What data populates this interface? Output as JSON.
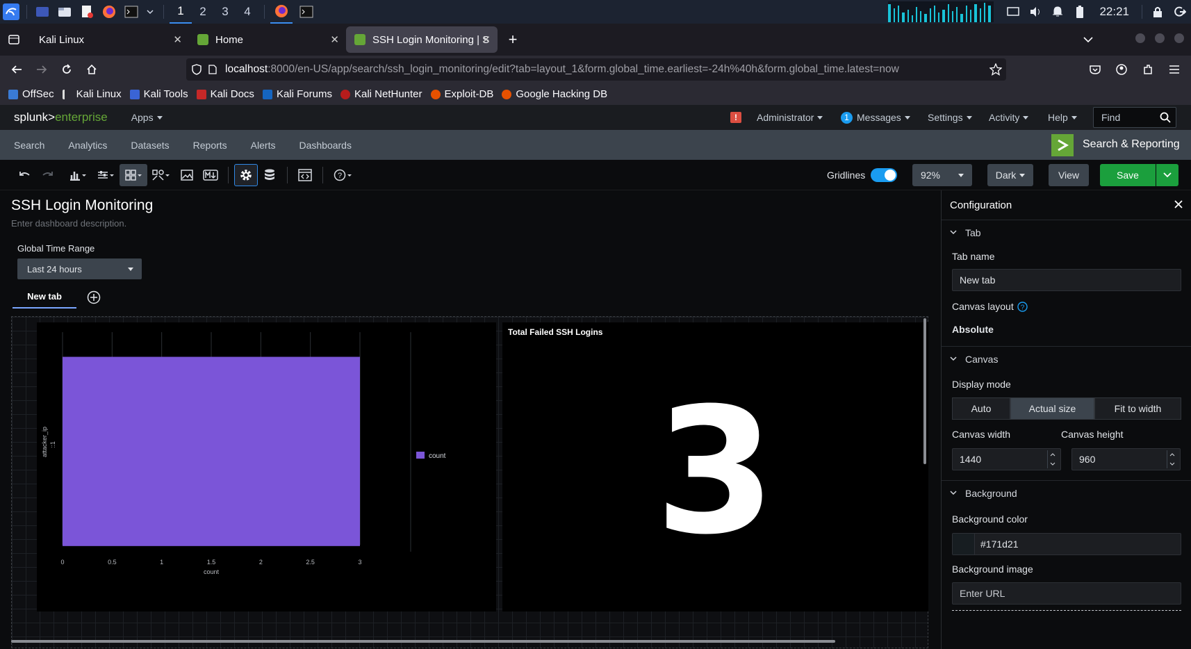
{
  "taskbar": {
    "workspaces": [
      "1",
      "2",
      "3",
      "4"
    ],
    "time": "22:21"
  },
  "browser": {
    "tabs": [
      {
        "title": "Kali Linux"
      },
      {
        "title": "Home"
      },
      {
        "title": "SSH Login Monitoring | Sp"
      }
    ],
    "url_host": "localhost",
    "url_rest": ":8000/en-US/app/search/ssh_login_monitoring/edit?tab=layout_1&form.global_time.earliest=-24h%40h&form.global_time.latest=now",
    "bookmarks": [
      "OffSec",
      "Kali Linux",
      "Kali Tools",
      "Kali Docs",
      "Kali Forums",
      "Kali NetHunter",
      "Exploit-DB",
      "Google Hacking DB"
    ]
  },
  "splunk": {
    "logo_brand": "splunk>",
    "logo_product": "enterprise",
    "apps_label": "Apps",
    "admin_label": "Administrator",
    "messages_count": "1",
    "messages_label": "Messages",
    "settings_label": "Settings",
    "activity_label": "Activity",
    "help_label": "Help",
    "find_placeholder": "Find",
    "app_nav": [
      "Search",
      "Analytics",
      "Datasets",
      "Reports",
      "Alerts",
      "Dashboards"
    ],
    "app_name": "Search & Reporting",
    "brand_color": "#65a637"
  },
  "toolbar": {
    "gridlines_label": "Gridlines",
    "gridlines_on": true,
    "zoom": "92%",
    "theme": "Dark",
    "view_label": "View",
    "save_label": "Save"
  },
  "dashboard": {
    "title": "SSH Login Monitoring",
    "description": "Enter dashboard description.",
    "time_input_label": "Global Time Range",
    "time_input_value": "Last 24 hours",
    "tab_label": "New tab",
    "single_value_title": "Total Failed SSH Logins",
    "single_value": "3"
  },
  "chart_data": {
    "type": "bar",
    "orientation": "horizontal",
    "categories": [
      "::1"
    ],
    "series": [
      {
        "name": "count",
        "values": [
          3
        ],
        "color": "#7b55d8"
      }
    ],
    "xlabel": "count",
    "ylabel": "attacker_ip",
    "xlim": [
      0,
      3
    ],
    "xticks": [
      "0",
      "0.5",
      "1",
      "1.5",
      "2",
      "2.5",
      "3"
    ],
    "legend": "right",
    "grid": true
  },
  "config": {
    "title": "Configuration",
    "tab_section": "Tab",
    "tab_name_label": "Tab name",
    "tab_name_value": "New tab",
    "canvas_layout_label": "Canvas layout",
    "canvas_layout_value": "Absolute",
    "canvas_section": "Canvas",
    "display_mode_label": "Display mode",
    "display_modes": [
      "Auto",
      "Actual size",
      "Fit to width"
    ],
    "display_mode_selected": "Actual size",
    "canvas_width_label": "Canvas width",
    "canvas_width": "1440",
    "canvas_height_label": "Canvas height",
    "canvas_height": "960",
    "background_section": "Background",
    "bg_color_label": "Background color",
    "bg_color_value": "#171d21",
    "bg_image_label": "Background image",
    "bg_image_placeholder": "Enter URL"
  }
}
